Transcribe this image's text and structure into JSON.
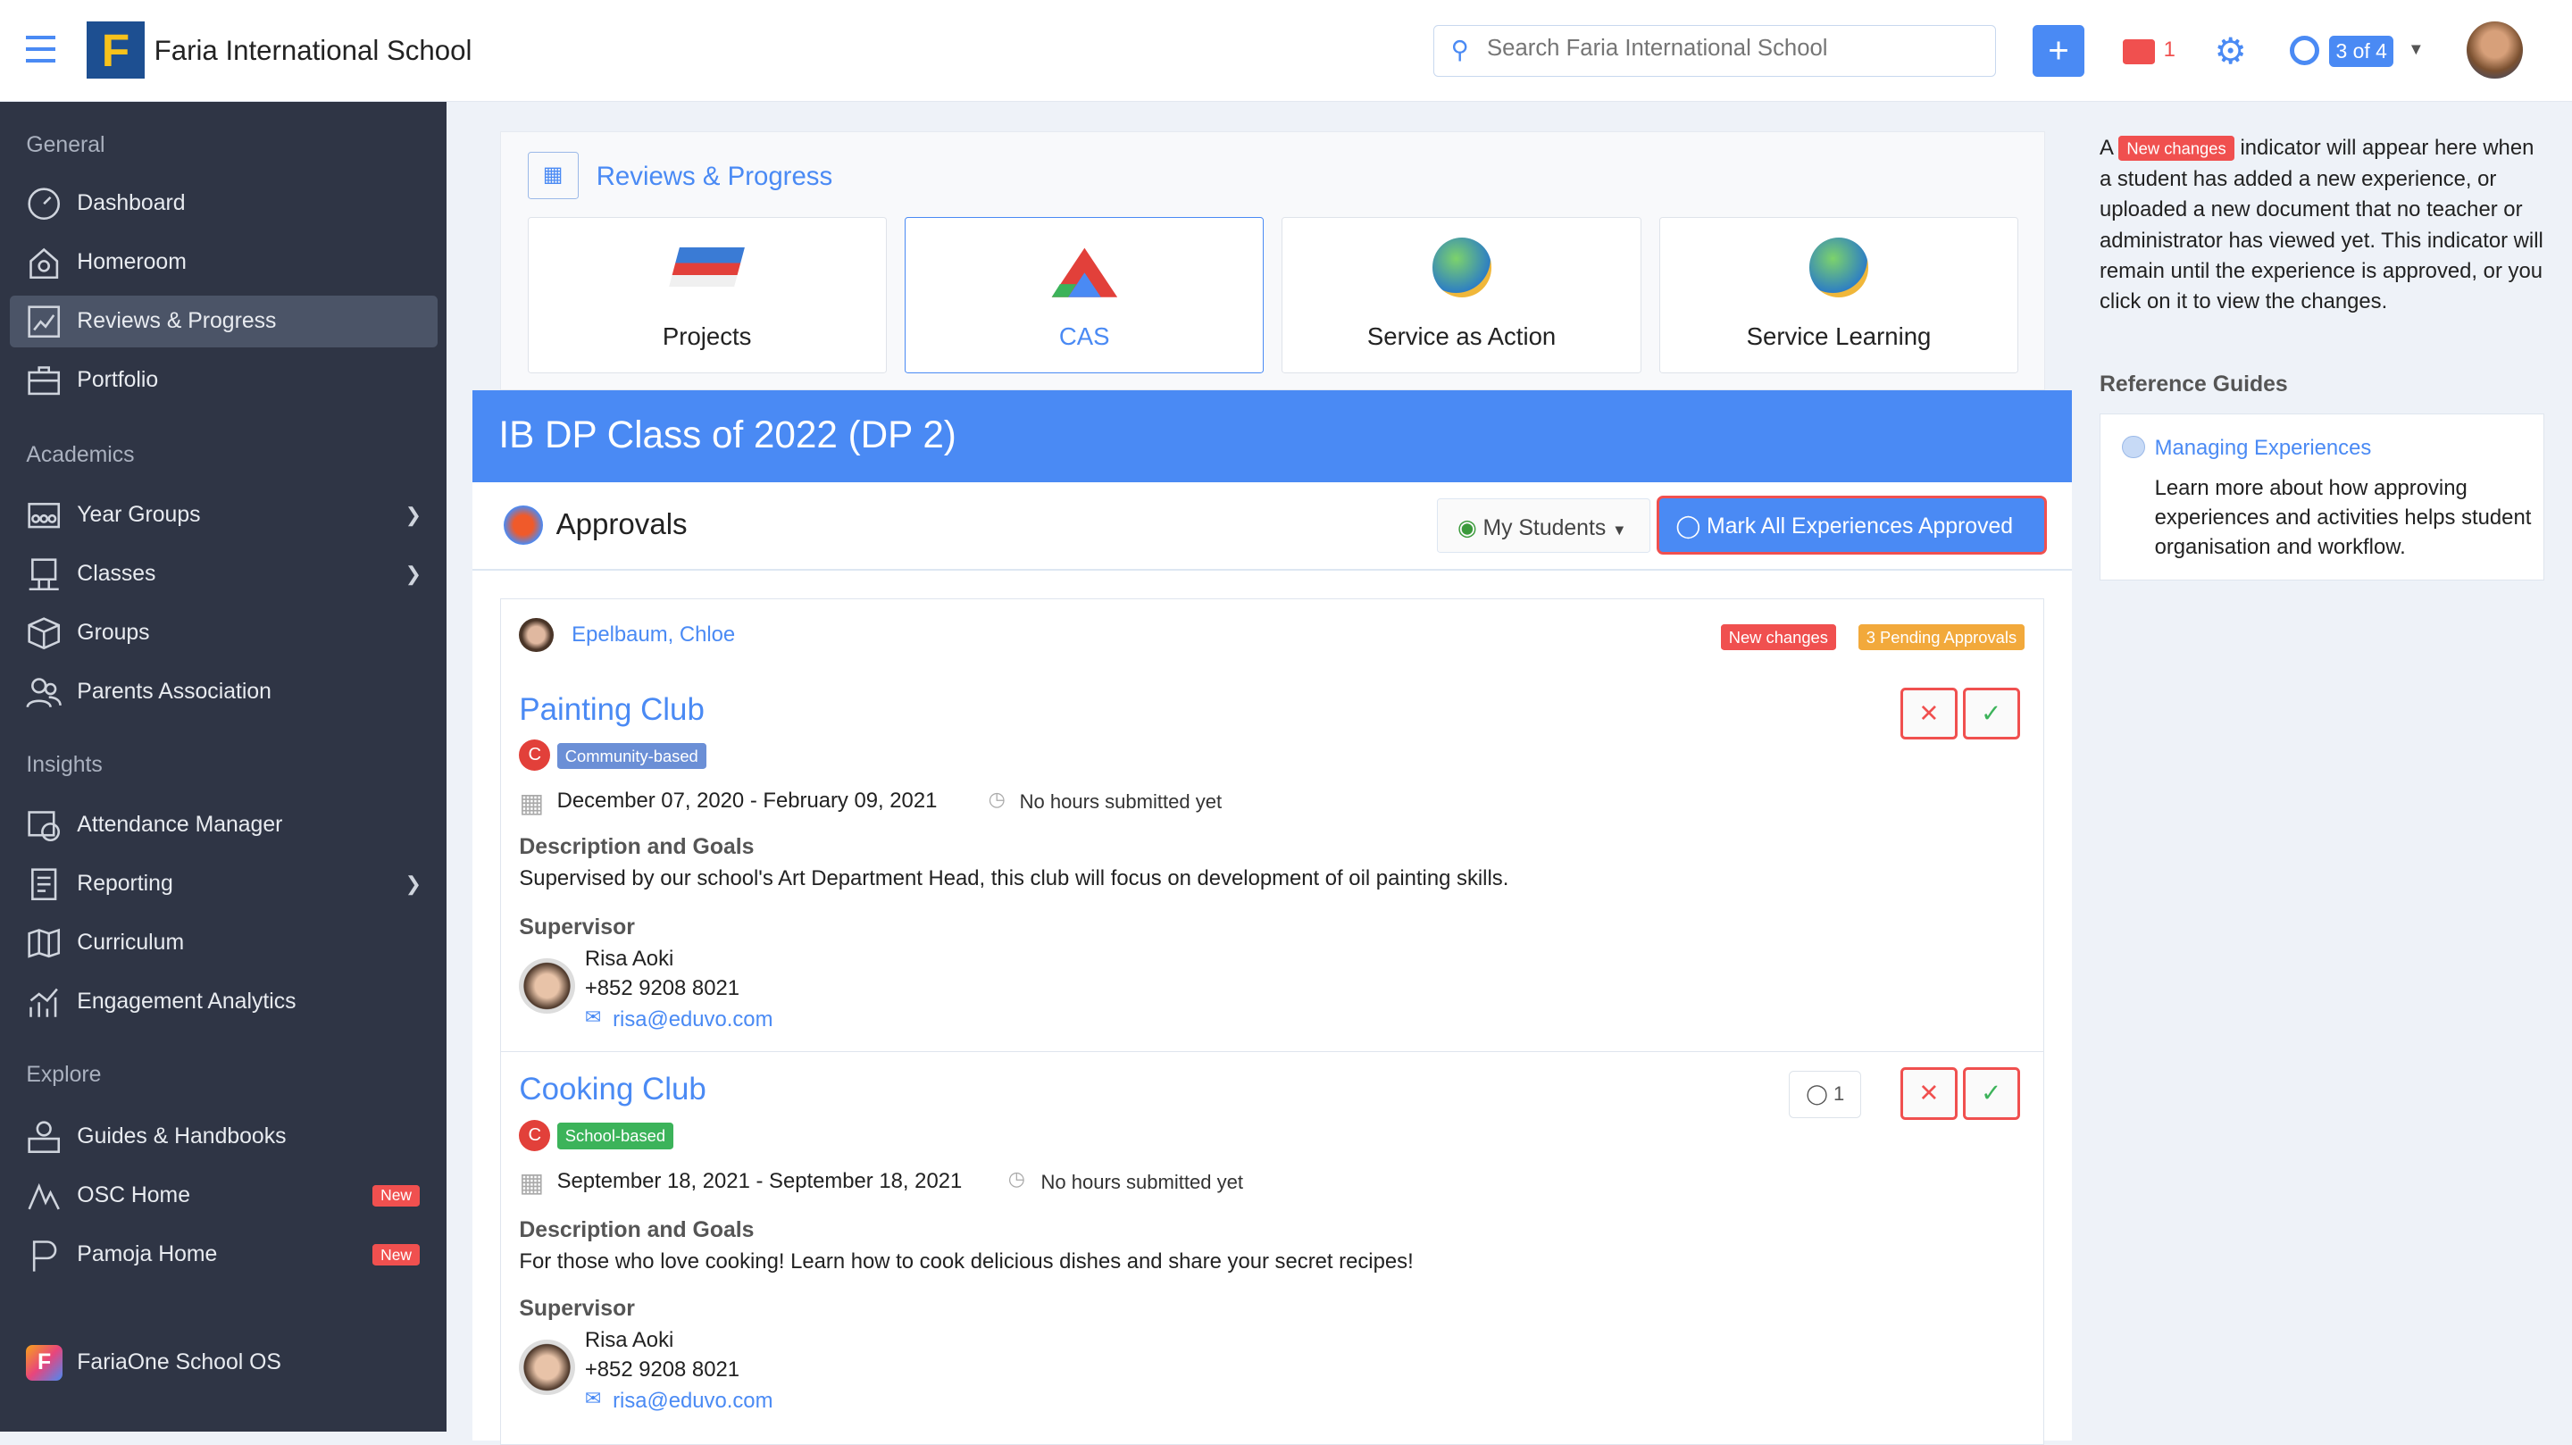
{
  "header": {
    "school": "Faria International School",
    "search_placeholder": "Search Faria International School",
    "mail_count": "1",
    "help_count": "3 of 4"
  },
  "sidebar": {
    "sections": [
      "General",
      "Academics",
      "Insights",
      "Explore"
    ],
    "general": [
      "Dashboard",
      "Homeroom",
      "Reviews & Progress",
      "Portfolio"
    ],
    "academics": [
      "Year Groups",
      "Classes",
      "Groups",
      "Parents Association"
    ],
    "insights": [
      "Attendance Manager",
      "Reporting",
      "Curriculum",
      "Engagement Analytics"
    ],
    "explore": [
      "Guides & Handbooks",
      "OSC Home",
      "Pamoja Home"
    ],
    "new_label": "New",
    "footer": "FariaOne School OS"
  },
  "tabs": {
    "title": "Reviews & Progress",
    "items": [
      "Projects",
      "CAS",
      "Service as Action",
      "Service Learning"
    ]
  },
  "main": {
    "class_title": "IB DP Class of 2022 (DP 2)",
    "approvals": "Approvals",
    "my_students": "My Students",
    "mark_all": "Mark All Experiences Approved",
    "student": "Epelbaum, Chloe",
    "new_changes": "New changes",
    "pending": "3 Pending Approvals",
    "experiences": [
      {
        "title": "Painting Club",
        "cat": "C",
        "type": "Community-based",
        "type_color": "#6b8fd6",
        "dates": "December 07, 2020 - February 09, 2021",
        "hours": "No hours submitted yet",
        "desc_label": "Description and Goals",
        "desc": "Supervised by our school's Art Department Head, this club will focus on development of oil painting skills.",
        "sup_label": "Supervisor",
        "sup_name": "Risa Aoki",
        "sup_phone": "+852 9208 8021",
        "sup_email": "risa@eduvo.com"
      },
      {
        "title": "Cooking Club",
        "cat": "C",
        "type": "School-based",
        "type_color": "#3cb35a",
        "dates": "September 18, 2021 - September 18, 2021",
        "hours": "No hours submitted yet",
        "comments": "1",
        "desc_label": "Description and Goals",
        "desc": "For those who love cooking! Learn how to cook delicious dishes and share your secret recipes!",
        "sup_label": "Supervisor",
        "sup_name": "Risa Aoki",
        "sup_phone": "+852 9208 8021",
        "sup_email": "risa@eduvo.com"
      }
    ]
  },
  "right": {
    "a": "A",
    "badge": "New changes",
    "info": "indicator will appear here when a student has added a new experience, or uploaded a new document that no teacher or administrator has viewed yet. This indicator will remain until the experience is approved, or you click on it to view the changes.",
    "ref_title": "Reference Guides",
    "guide_link": "Managing Experiences",
    "guide_text": "Learn more about how approving experiences and activities helps student organisation and workflow."
  }
}
